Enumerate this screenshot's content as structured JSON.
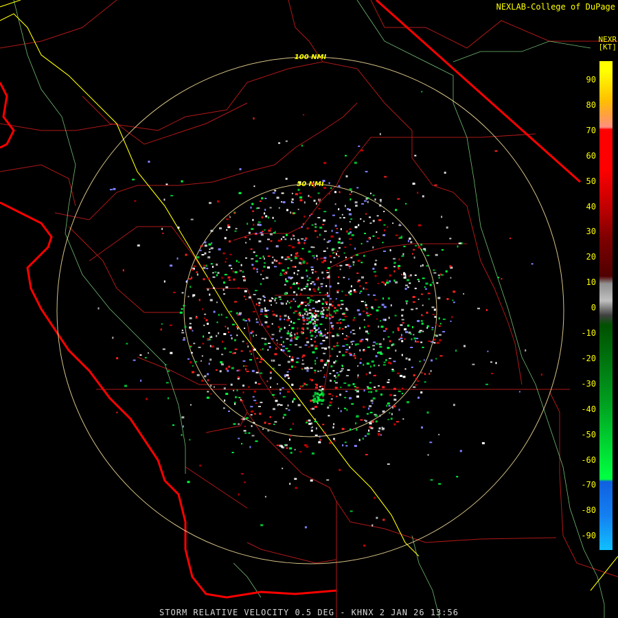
{
  "credit": "NEXLAB-College of DuPage",
  "product": "NEXR",
  "units": "[KT]",
  "footer": "STORM RELATIVE VELOCITY 0.5 DEG - KHNX 2 JAN 26 13:56",
  "range_rings": [
    "50 NMI",
    "100 NMI"
  ],
  "scale": {
    "labels": [
      "90",
      "80",
      "70",
      "60",
      "50",
      "40",
      "30",
      "20",
      "10",
      "0",
      "-10",
      "-20",
      "-30",
      "-40",
      "-50",
      "-60",
      "-70",
      "-80",
      "-90"
    ],
    "colors": {
      "top": "#ffff00",
      "orange": "#ffa040",
      "salmon": "#ff9080",
      "red": "#ff0000",
      "darkred": "#500000",
      "gray": "#c0c0c0",
      "darkgreen": "#005000",
      "green": "#00ff40",
      "blue": "#1060e0",
      "lightblue": "#10c0ff"
    }
  },
  "colors": {
    "county_lines": "#b01818",
    "state_line": "#ff1010",
    "coast": "#ff0000",
    "highway": "#ffff00",
    "rivers": "#88e088",
    "rings": "#ffe8a0"
  }
}
